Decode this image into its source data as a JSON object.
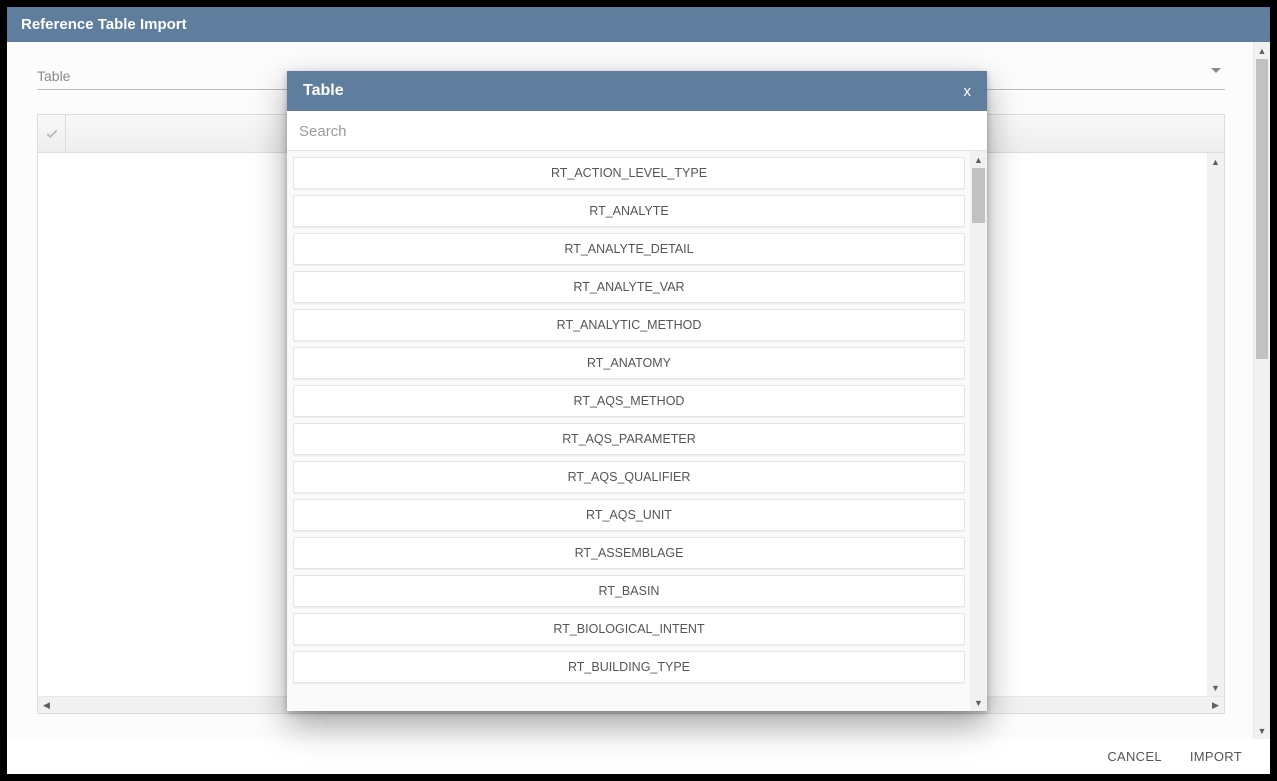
{
  "header": {
    "title": "Reference Table Import"
  },
  "table_field": {
    "placeholder": "Table"
  },
  "footer": {
    "cancel": "CANCEL",
    "import": "IMPORT"
  },
  "modal": {
    "title": "Table",
    "close": "x",
    "search_placeholder": "Search",
    "items": [
      "RT_ACTION_LEVEL_TYPE",
      "RT_ANALYTE",
      "RT_ANALYTE_DETAIL",
      "RT_ANALYTE_VAR",
      "RT_ANALYTIC_METHOD",
      "RT_ANATOMY",
      "RT_AQS_METHOD",
      "RT_AQS_PARAMETER",
      "RT_AQS_QUALIFIER",
      "RT_AQS_UNIT",
      "RT_ASSEMBLAGE",
      "RT_BASIN",
      "RT_BIOLOGICAL_INTENT",
      "RT_BUILDING_TYPE"
    ]
  }
}
